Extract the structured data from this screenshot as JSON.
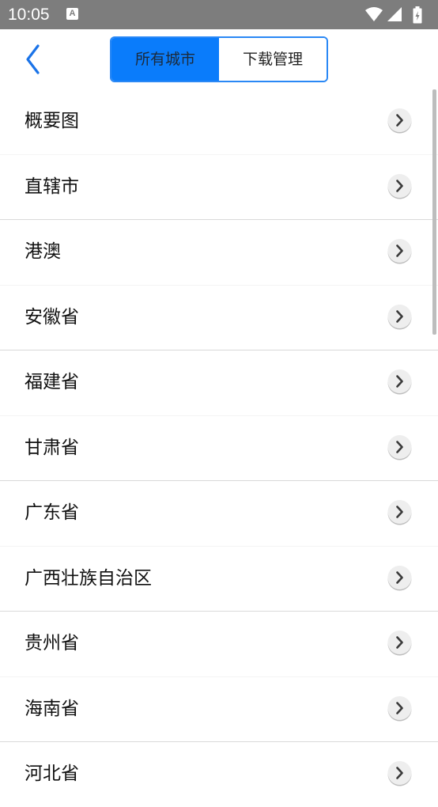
{
  "status_bar": {
    "time": "10:05",
    "notification_icon": "a-icon",
    "right_icons": [
      "wifi-icon",
      "signal-icon",
      "battery-icon"
    ]
  },
  "header": {
    "back_icon": "chevron-left-icon",
    "tabs": [
      {
        "label": "所有城市",
        "active": true
      },
      {
        "label": "下载管理",
        "active": false
      }
    ]
  },
  "list": {
    "items": [
      {
        "label": "概要图"
      },
      {
        "label": "直辖市"
      },
      {
        "label": "港澳"
      },
      {
        "label": "安徽省"
      },
      {
        "label": "福建省"
      },
      {
        "label": "甘肃省"
      },
      {
        "label": "广东省"
      },
      {
        "label": "广西壮族自治区"
      },
      {
        "label": "贵州省"
      },
      {
        "label": "海南省"
      },
      {
        "label": "河北省"
      }
    ],
    "item_icon": "chevron-right-circle-icon"
  },
  "colors": {
    "status_bar": "#7d7d7d",
    "accent": "#0a7cfb",
    "back_arrow": "#1a73e8"
  }
}
